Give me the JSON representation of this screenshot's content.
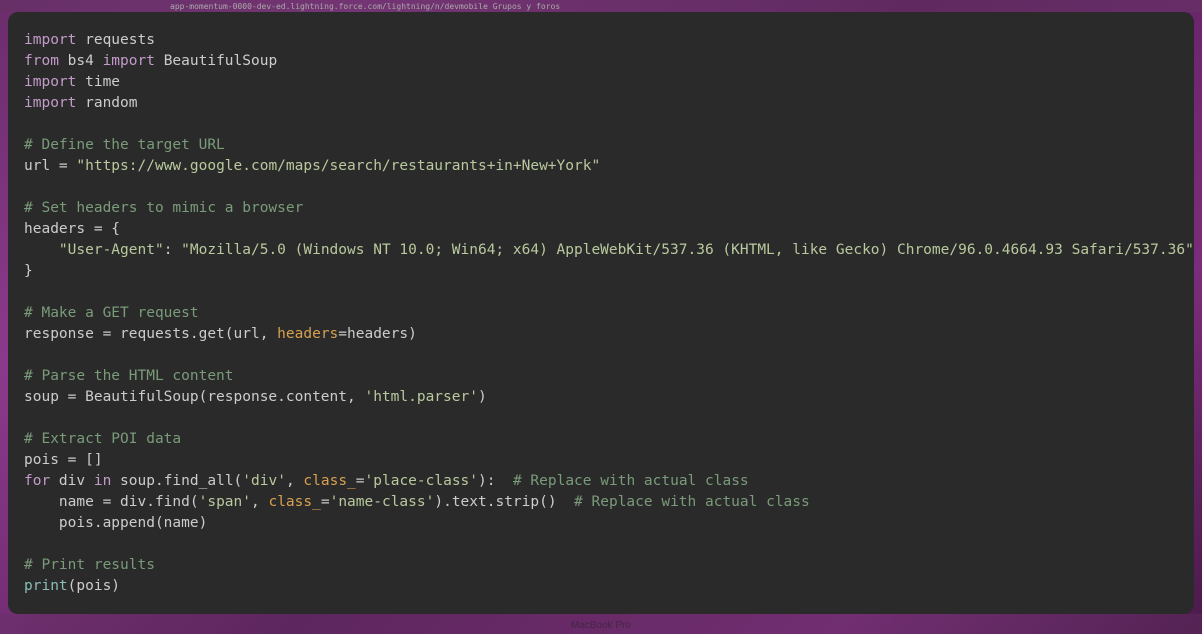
{
  "background": {
    "url_bar": "app-momentum-0000-dev-ed.lightning.force.com/lightning/n/devmobile   Grupos y foros",
    "macbook": "MacBook Pro"
  },
  "code": {
    "l1a": "import",
    "l1b": " requests",
    "l2a": "from",
    "l2b": " bs4 ",
    "l2c": "import",
    "l2d": " BeautifulSoup",
    "l3a": "import",
    "l3b": " time",
    "l4a": "import",
    "l4b": " random",
    "l6": "# Define the target URL",
    "l7a": "url = ",
    "l7b": "\"https://www.google.com/maps/search/restaurants+in+New+York\"",
    "l9": "# Set headers to mimic a browser",
    "l10": "headers = {",
    "l11a": "    ",
    "l11b": "\"User-Agent\"",
    "l11c": ": ",
    "l11d": "\"Mozilla/5.0 (Windows NT 10.0; Win64; x64) AppleWebKit/537.36 (KHTML, like Gecko) Chrome/96.0.4664.93 Safari/537.36\"",
    "l12": "}",
    "l14": "# Make a GET request",
    "l15a": "response = requests.get(url, ",
    "l15b": "headers",
    "l15c": "=headers)",
    "l17": "# Parse the HTML content",
    "l18a": "soup = BeautifulSoup(response.content, ",
    "l18b": "'html.parser'",
    "l18c": ")",
    "l20": "# Extract POI data",
    "l21": "pois = []",
    "l22a": "for",
    "l22b": " div ",
    "l22c": "in",
    "l22d": " soup.find_all(",
    "l22e": "'div'",
    "l22f": ", ",
    "l22g": "class_",
    "l22h": "=",
    "l22i": "'place-class'",
    "l22j": "):  ",
    "l22k": "# Replace with actual class",
    "l23a": "    name = div.find(",
    "l23b": "'span'",
    "l23c": ", ",
    "l23d": "class_",
    "l23e": "=",
    "l23f": "'name-class'",
    "l23g": ").text.strip()  ",
    "l23h": "# Replace with actual class",
    "l24": "    pois.append(name)",
    "l26": "# Print results",
    "l27a": "print",
    "l27b": "(pois)"
  }
}
